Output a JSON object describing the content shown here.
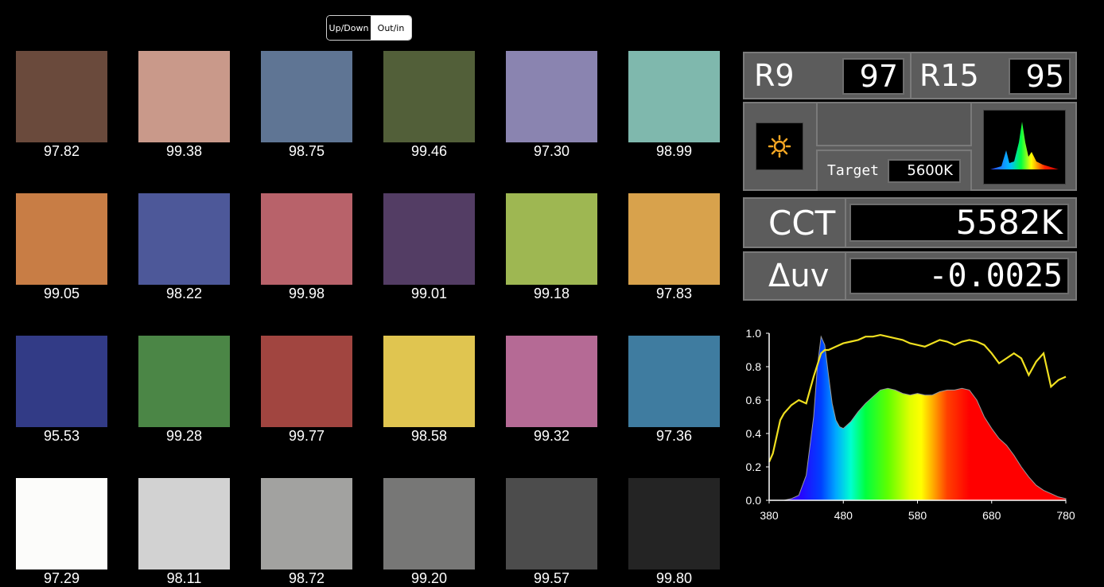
{
  "toggle": {
    "left": "Up/Down",
    "right": "Out/in"
  },
  "swatches": [
    {
      "color": "#6a4a3c",
      "value": "97.82"
    },
    {
      "color": "#c9998a",
      "value": "99.38"
    },
    {
      "color": "#5f7594",
      "value": "98.75"
    },
    {
      "color": "#525f39",
      "value": "99.46"
    },
    {
      "color": "#8a84b0",
      "value": "97.30"
    },
    {
      "color": "#7fb8ad",
      "value": "98.99"
    },
    {
      "color": "#c87d45",
      "value": "99.05"
    },
    {
      "color": "#4d5899",
      "value": "98.22"
    },
    {
      "color": "#b8626a",
      "value": "99.98"
    },
    {
      "color": "#533d64",
      "value": "99.01"
    },
    {
      "color": "#9eb752",
      "value": "99.18"
    },
    {
      "color": "#d8a24c",
      "value": "97.83"
    },
    {
      "color": "#323b86",
      "value": "95.53"
    },
    {
      "color": "#4b8646",
      "value": "99.28"
    },
    {
      "color": "#a14540",
      "value": "99.77"
    },
    {
      "color": "#e0c550",
      "value": "98.58"
    },
    {
      "color": "#b56a95",
      "value": "99.32"
    },
    {
      "color": "#3f7ca0",
      "value": "97.36"
    },
    {
      "color": "#fcfcfa",
      "value": "97.29"
    },
    {
      "color": "#d2d2d2",
      "value": "98.11"
    },
    {
      "color": "#a2a2a0",
      "value": "98.72"
    },
    {
      "color": "#777776",
      "value": "99.20"
    },
    {
      "color": "#4c4c4c",
      "value": "99.57"
    },
    {
      "color": "#242424",
      "value": "99.80"
    }
  ],
  "metrics": {
    "r9_label": "R9",
    "r9_value": "97",
    "r15_label": "R15",
    "r15_value": "95",
    "target_label": "Target",
    "target_value": "5600K",
    "cct_label": "CCT",
    "cct_value": "5582K",
    "duv_label": "Δuv",
    "duv_value": "-0.0025",
    "sun_icon": "sun-icon",
    "spectrum_thumb_icon": "spectrum-thumbnail-icon"
  },
  "chart_data": {
    "type": "area",
    "xlabel": "",
    "ylabel": "",
    "xlim": [
      380,
      780
    ],
    "ylim": [
      0,
      1.0
    ],
    "x_ticks": [
      "380",
      "480",
      "580",
      "680",
      "780"
    ],
    "y_ticks": [
      "0.0",
      "0.2",
      "0.4",
      "0.6",
      "0.8",
      "1.0"
    ],
    "grid": false,
    "series": [
      {
        "style": "rainbow-filled-area",
        "x": [
          380,
          400,
          410,
          420,
          430,
          440,
          445,
          450,
          455,
          460,
          465,
          470,
          475,
          480,
          490,
          500,
          510,
          520,
          530,
          540,
          550,
          560,
          570,
          580,
          590,
          600,
          610,
          620,
          630,
          640,
          650,
          660,
          670,
          680,
          690,
          700,
          710,
          720,
          730,
          740,
          750,
          760,
          770,
          780
        ],
        "y": [
          0.0,
          0.0,
          0.01,
          0.03,
          0.15,
          0.5,
          0.8,
          0.98,
          0.93,
          0.75,
          0.58,
          0.48,
          0.44,
          0.43,
          0.47,
          0.53,
          0.58,
          0.62,
          0.66,
          0.67,
          0.66,
          0.64,
          0.63,
          0.64,
          0.63,
          0.63,
          0.65,
          0.66,
          0.66,
          0.67,
          0.66,
          0.6,
          0.5,
          0.43,
          0.37,
          0.33,
          0.27,
          0.2,
          0.14,
          0.09,
          0.06,
          0.04,
          0.02,
          0.01
        ]
      },
      {
        "style": "yellow-line",
        "color": "#f0e020",
        "x": [
          380,
          385,
          390,
          395,
          400,
          410,
          420,
          430,
          440,
          450,
          455,
          460,
          470,
          480,
          490,
          500,
          510,
          520,
          530,
          540,
          550,
          560,
          570,
          580,
          590,
          600,
          610,
          620,
          630,
          640,
          650,
          660,
          670,
          680,
          690,
          700,
          710,
          720,
          730,
          740,
          750,
          760,
          770,
          780
        ],
        "y": [
          0.23,
          0.28,
          0.38,
          0.48,
          0.52,
          0.57,
          0.6,
          0.58,
          0.74,
          0.88,
          0.9,
          0.9,
          0.92,
          0.94,
          0.95,
          0.96,
          0.98,
          0.98,
          0.99,
          0.98,
          0.97,
          0.96,
          0.94,
          0.93,
          0.92,
          0.94,
          0.96,
          0.95,
          0.93,
          0.95,
          0.96,
          0.95,
          0.93,
          0.88,
          0.82,
          0.85,
          0.88,
          0.85,
          0.75,
          0.83,
          0.88,
          0.68,
          0.72,
          0.74
        ]
      }
    ]
  }
}
